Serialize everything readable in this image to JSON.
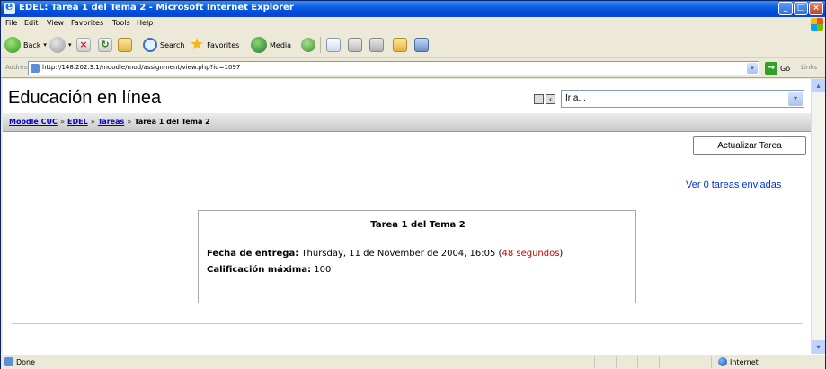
{
  "window": {
    "title": "EDEL: Tarea 1 del Tema 2 - Microsoft Internet Explorer",
    "minimize_glyph": "_",
    "maximize_glyph": "□",
    "close_glyph": "×"
  },
  "menu": {
    "items": [
      "File",
      "Edit",
      "View",
      "Favorites",
      "Tools",
      "Help"
    ]
  },
  "toolbar": {
    "back_label": "Back",
    "search_label": "Search",
    "favorites_label": "Favorites",
    "media_label": "Media"
  },
  "address": {
    "label": "Address",
    "url": "http://148.202.3.1/moodle/mod/assignment/view.php?id=1097",
    "go_label": "Go",
    "links_label": "Links"
  },
  "page": {
    "site_title": "Educación en línea",
    "jump_value": "Ir a...",
    "breadcrumb": {
      "items": [
        "Moodle CUC",
        "EDEL",
        "Tareas"
      ],
      "current": "Tarea 1 del Tema 2",
      "separator": "»"
    },
    "update_button": "Actualizar Tarea",
    "view_link": "Ver 0 tareas enviadas",
    "assignment": {
      "title": "Tarea 1 del Tema 2",
      "due_label": "Fecha de entrega:",
      "due_value": "Thursday, 11 de November de 2004, 16:05",
      "due_remaining": "48 segundos",
      "grade_label": "Calificación máxima:",
      "grade_value": "100"
    }
  },
  "status": {
    "text": "Done",
    "zone": "Internet"
  },
  "colors": {
    "titlebar": "#0a5ee0",
    "link": "#0033cc",
    "remaining_time": "#cc0000"
  }
}
